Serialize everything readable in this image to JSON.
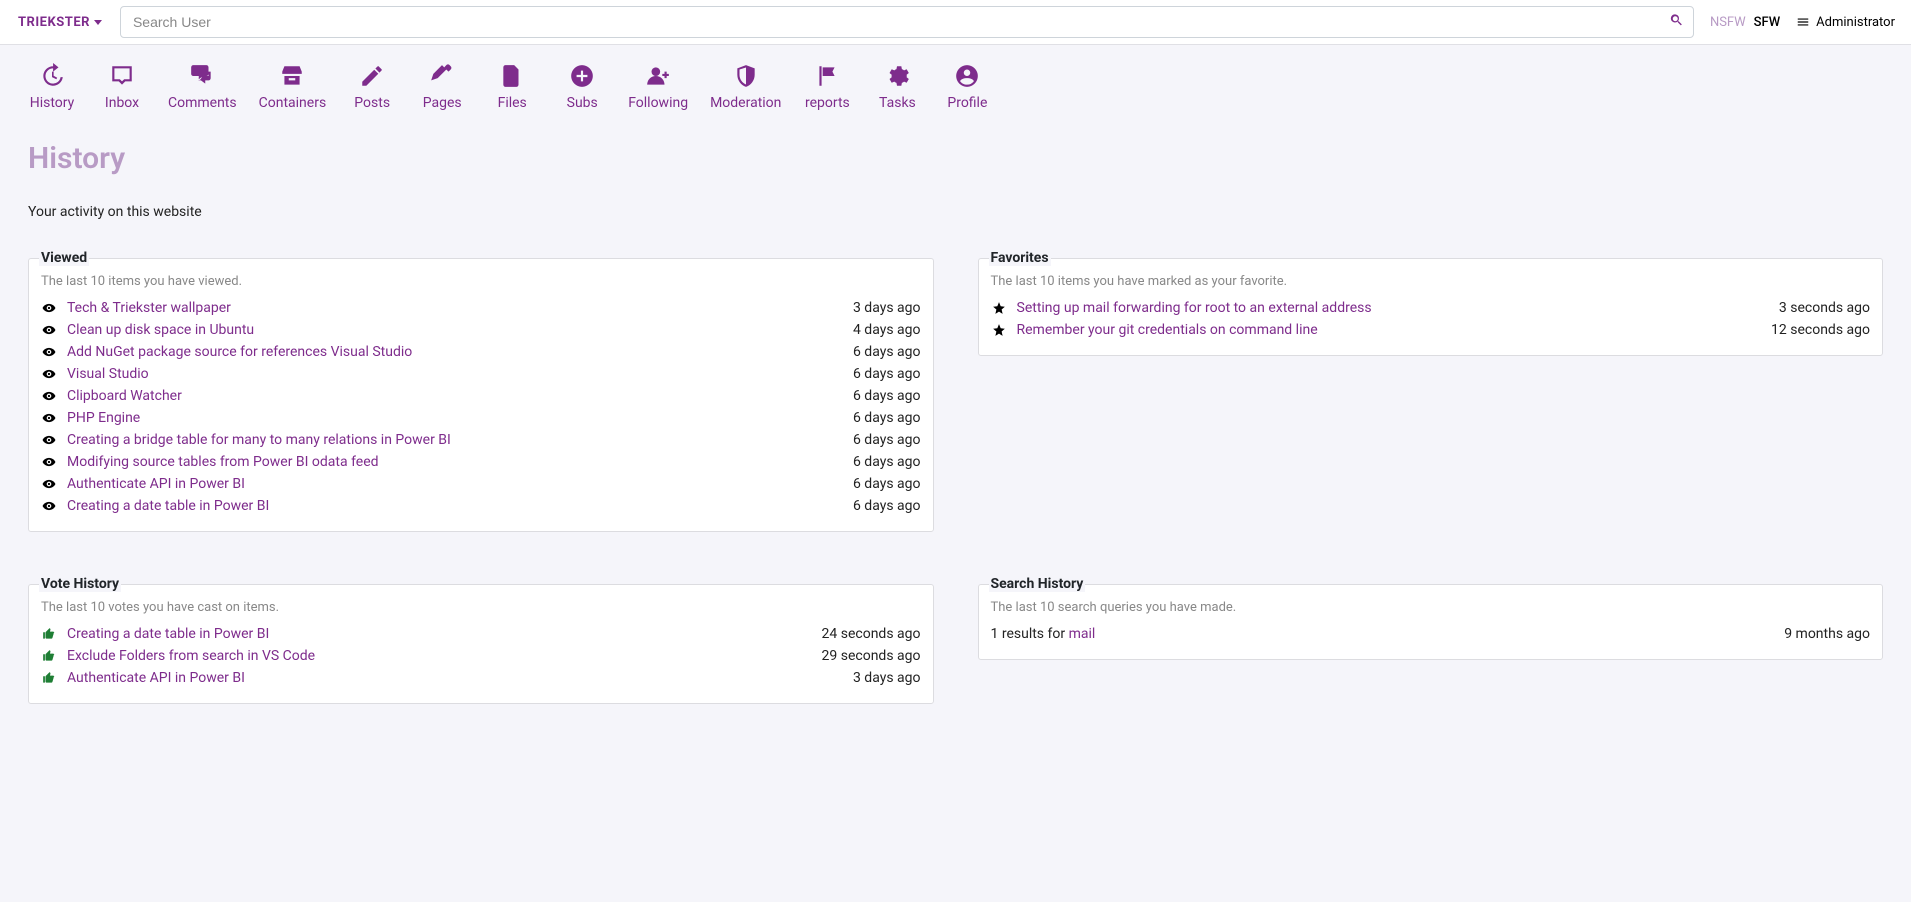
{
  "header": {
    "brand": "TRIEKSTER",
    "search_placeholder": "Search User",
    "nsfw_label": "NSFW",
    "sfw_label": "SFW",
    "admin_label": "Administrator"
  },
  "nav": [
    {
      "label": "History",
      "icon": "history"
    },
    {
      "label": "Inbox",
      "icon": "inbox"
    },
    {
      "label": "Comments",
      "icon": "comments"
    },
    {
      "label": "Containers",
      "icon": "box"
    },
    {
      "label": "Posts",
      "icon": "pencil"
    },
    {
      "label": "Pages",
      "icon": "pen"
    },
    {
      "label": "Files",
      "icon": "file"
    },
    {
      "label": "Subs",
      "icon": "plus-circle"
    },
    {
      "label": "Following",
      "icon": "user-plus"
    },
    {
      "label": "Moderation",
      "icon": "shield"
    },
    {
      "label": "reports",
      "icon": "flag"
    },
    {
      "label": "Tasks",
      "icon": "gear"
    },
    {
      "label": "Profile",
      "icon": "user-circle"
    }
  ],
  "page": {
    "title": "History",
    "subtitle": "Your activity on this website"
  },
  "panels": {
    "viewed": {
      "legend": "Viewed",
      "desc": "The last 10 items you have viewed.",
      "items": [
        {
          "title": "Tech & Triekster wallpaper",
          "time": "3 days ago"
        },
        {
          "title": "Clean up disk space in Ubuntu",
          "time": "4 days ago"
        },
        {
          "title": "Add NuGet package source for references Visual Studio",
          "time": "6 days ago"
        },
        {
          "title": "Visual Studio",
          "time": "6 days ago"
        },
        {
          "title": "Clipboard Watcher",
          "time": "6 days ago"
        },
        {
          "title": "PHP Engine",
          "time": "6 days ago"
        },
        {
          "title": "Creating a bridge table for many to many relations in Power BI",
          "time": "6 days ago"
        },
        {
          "title": "Modifying source tables from Power BI odata feed",
          "time": "6 days ago"
        },
        {
          "title": "Authenticate API in Power BI",
          "time": "6 days ago"
        },
        {
          "title": "Creating a date table in Power BI",
          "time": "6 days ago"
        }
      ]
    },
    "favorites": {
      "legend": "Favorites",
      "desc": "The last 10 items you have marked as your favorite.",
      "items": [
        {
          "title": "Setting up mail forwarding for root to an external address",
          "time": "3 seconds ago"
        },
        {
          "title": "Remember your git credentials on command line",
          "time": "12 seconds ago"
        }
      ]
    },
    "votes": {
      "legend": "Vote History",
      "desc": "The last 10 votes you have cast on items.",
      "items": [
        {
          "title": "Creating a date table in Power BI",
          "time": "24 seconds ago"
        },
        {
          "title": "Exclude Folders from search in VS Code",
          "time": "29 seconds ago"
        },
        {
          "title": "Authenticate API in Power BI",
          "time": "3 days ago"
        }
      ]
    },
    "search": {
      "legend": "Search History",
      "desc": "The last 10 search queries you have made.",
      "items": [
        {
          "prefix": "1 results for ",
          "query": "mail",
          "time": "9 months ago"
        }
      ]
    }
  }
}
